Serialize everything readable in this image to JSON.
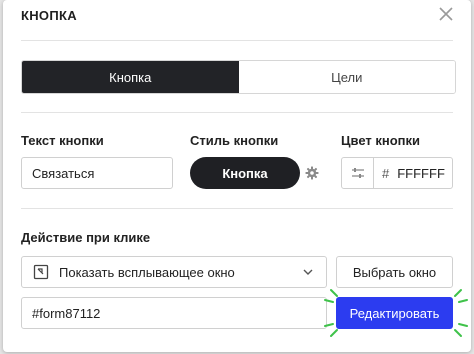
{
  "dialog": {
    "title": "КНОПКА",
    "close_icon": "close-icon"
  },
  "tabs": [
    {
      "label": "Кнопка",
      "active": true
    },
    {
      "label": "Цели",
      "active": false
    }
  ],
  "button_text": {
    "label": "Текст кнопки",
    "value": "Связаться"
  },
  "button_style": {
    "label": "Стиль кнопки",
    "preview_label": "Кнопка",
    "settings_icon": "gear-icon"
  },
  "button_color": {
    "label": "Цвет кнопки",
    "icon": "color-sliders-icon",
    "hash": "#",
    "value": "FFFFFF"
  },
  "click_action": {
    "label": "Действие при клике",
    "select_icon": "popup-window-icon",
    "selected": "Показать всплывающее окно",
    "choose_label": "Выбрать окно",
    "form_id": "#form87112",
    "edit_label": "Редактировать"
  },
  "colors": {
    "primary": "#2c3cf0",
    "dark": "#222327",
    "highlight": "#3fc24a"
  }
}
